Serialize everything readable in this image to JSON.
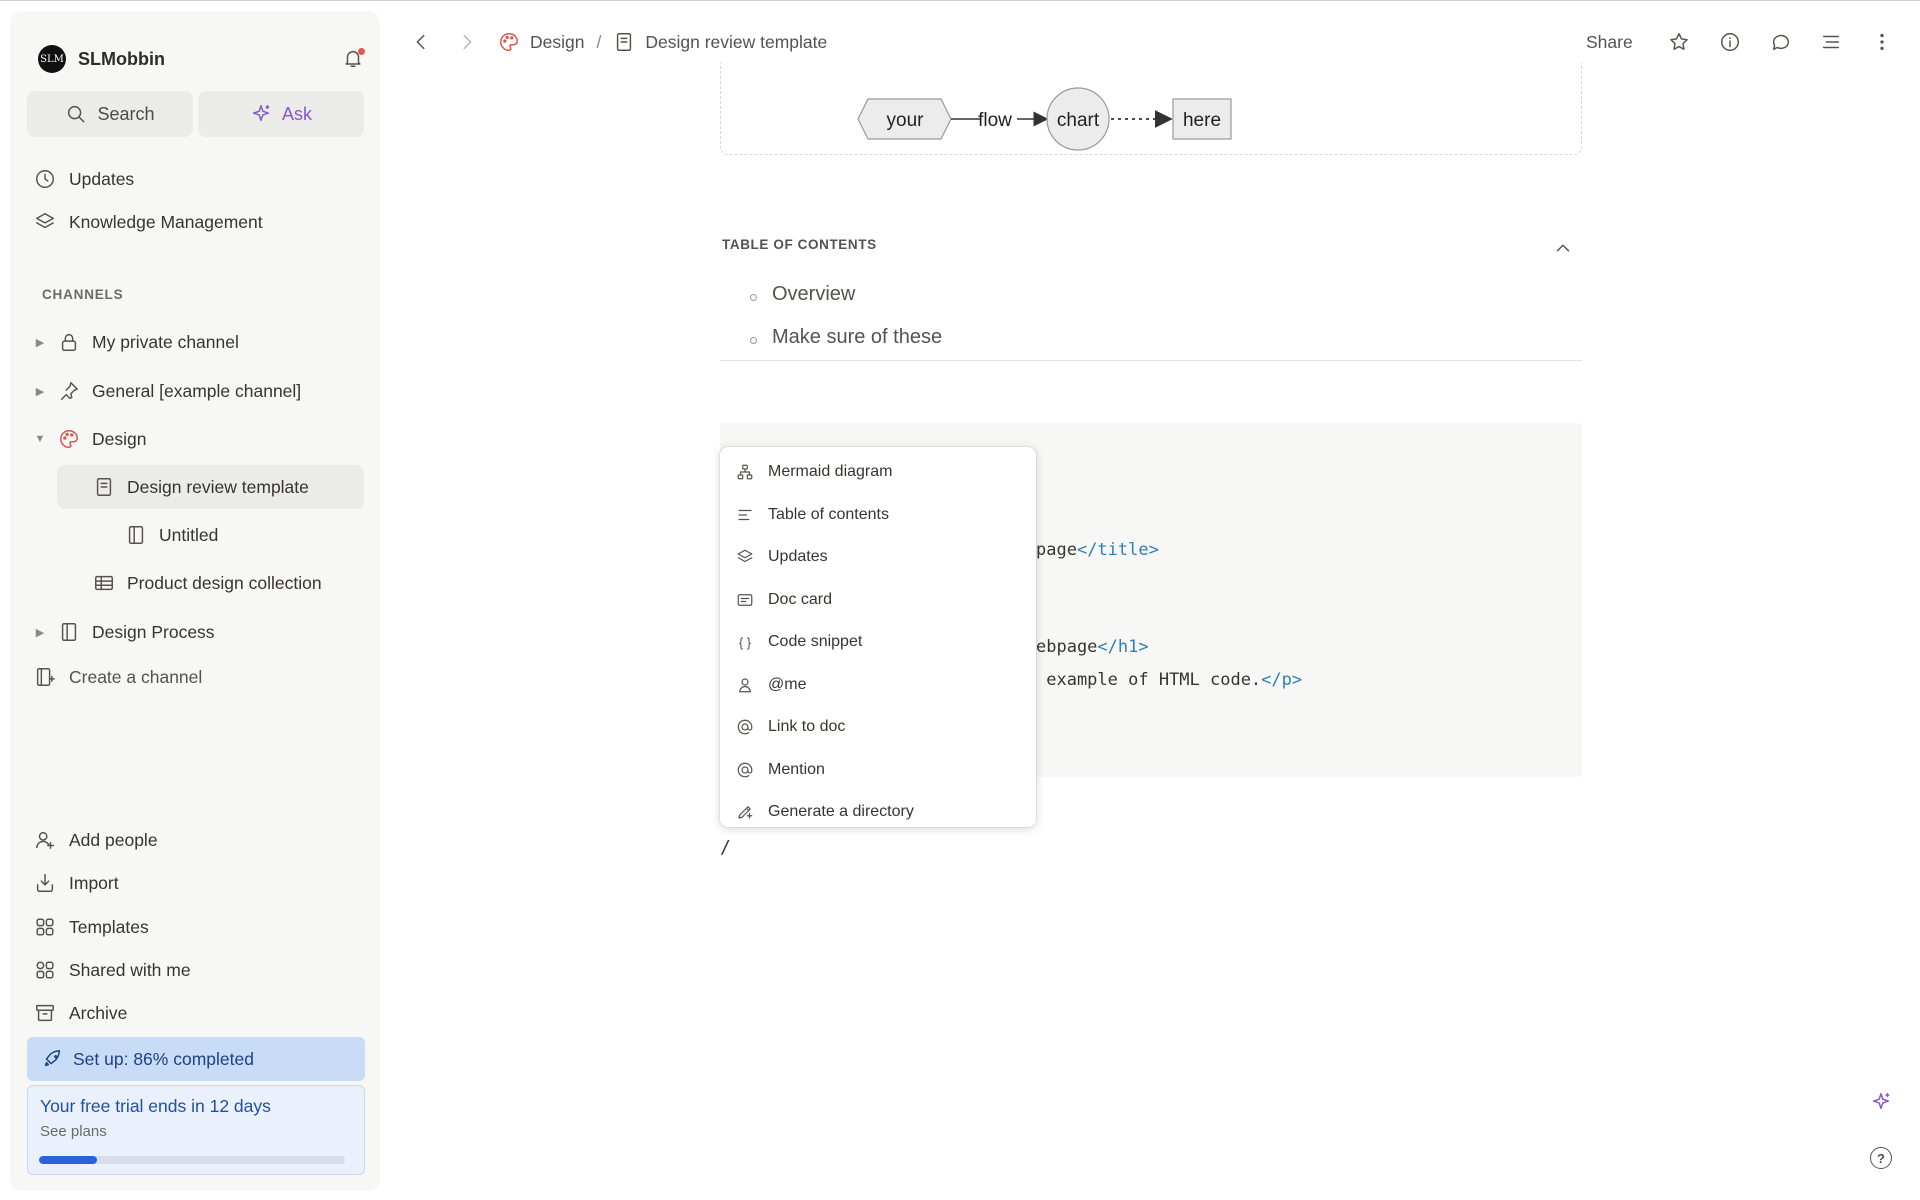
{
  "workspace": {
    "name": "SLMobbin",
    "avatar_text": "SLM"
  },
  "sidebar": {
    "search_label": "Search",
    "ask_label": "Ask",
    "top_items": [
      {
        "label": "Updates",
        "icon": "clock-icon"
      },
      {
        "label": "Knowledge Management",
        "icon": "layers-icon"
      }
    ],
    "channels_label": "CHANNELS",
    "channels": [
      {
        "label": "My private channel",
        "icon": "lock-icon"
      },
      {
        "label": "General [example channel]",
        "icon": "pin-icon"
      },
      {
        "label": "Design",
        "icon": "palette-icon"
      },
      {
        "label": "Design review template",
        "icon": "doc-icon"
      },
      {
        "label": "Untitled",
        "icon": "book-icon"
      },
      {
        "label": "Product design collection",
        "icon": "table-icon"
      },
      {
        "label": "Design Process",
        "icon": "book-icon"
      }
    ],
    "create_channel_label": "Create a channel",
    "bottom_items": [
      {
        "label": "Add people",
        "icon": "add-person-icon"
      },
      {
        "label": "Import",
        "icon": "import-icon"
      },
      {
        "label": "Templates",
        "icon": "templates-icon"
      },
      {
        "label": "Shared with me",
        "icon": "people-icon"
      },
      {
        "label": "Archive",
        "icon": "archive-icon"
      }
    ],
    "setup": {
      "label": "Set up: 86% completed",
      "percent": 86
    },
    "trial": {
      "title": "Your free trial ends in 12 days",
      "subtitle": "See plans",
      "progress_fraction": 0.19
    }
  },
  "topbar": {
    "breadcrumb": [
      "Design",
      "Design review template"
    ],
    "share_label": "Share"
  },
  "flowchart": {
    "nodes": [
      "your",
      "flow",
      "chart",
      "here"
    ]
  },
  "toc": {
    "label": "TABLE OF CONTENTS",
    "items": [
      "Overview",
      "Make sure of these"
    ]
  },
  "code": {
    "line1_text": "page",
    "line1_tag": "</title>",
    "line2_text": "ebpage",
    "line2_tag": "</h1>",
    "line3_text": " example of HTML code.",
    "line3_tag": "</p>"
  },
  "slash_menu": {
    "items": [
      {
        "label": "Mermaid diagram",
        "icon": "diagram-icon"
      },
      {
        "label": "Table of contents",
        "icon": "toc-icon"
      },
      {
        "label": "Updates",
        "icon": "layers-icon"
      },
      {
        "label": "Doc card",
        "icon": "doc-card-icon"
      },
      {
        "label": "Code snippet",
        "icon": "braces-icon"
      },
      {
        "label": "@me",
        "icon": "person-icon"
      },
      {
        "label": "Link to doc",
        "icon": "at-icon"
      },
      {
        "label": "Mention",
        "icon": "at-icon"
      },
      {
        "label": "Generate a directory",
        "icon": "pen-icon"
      }
    ]
  },
  "editor": {
    "slash_text": "/"
  }
}
